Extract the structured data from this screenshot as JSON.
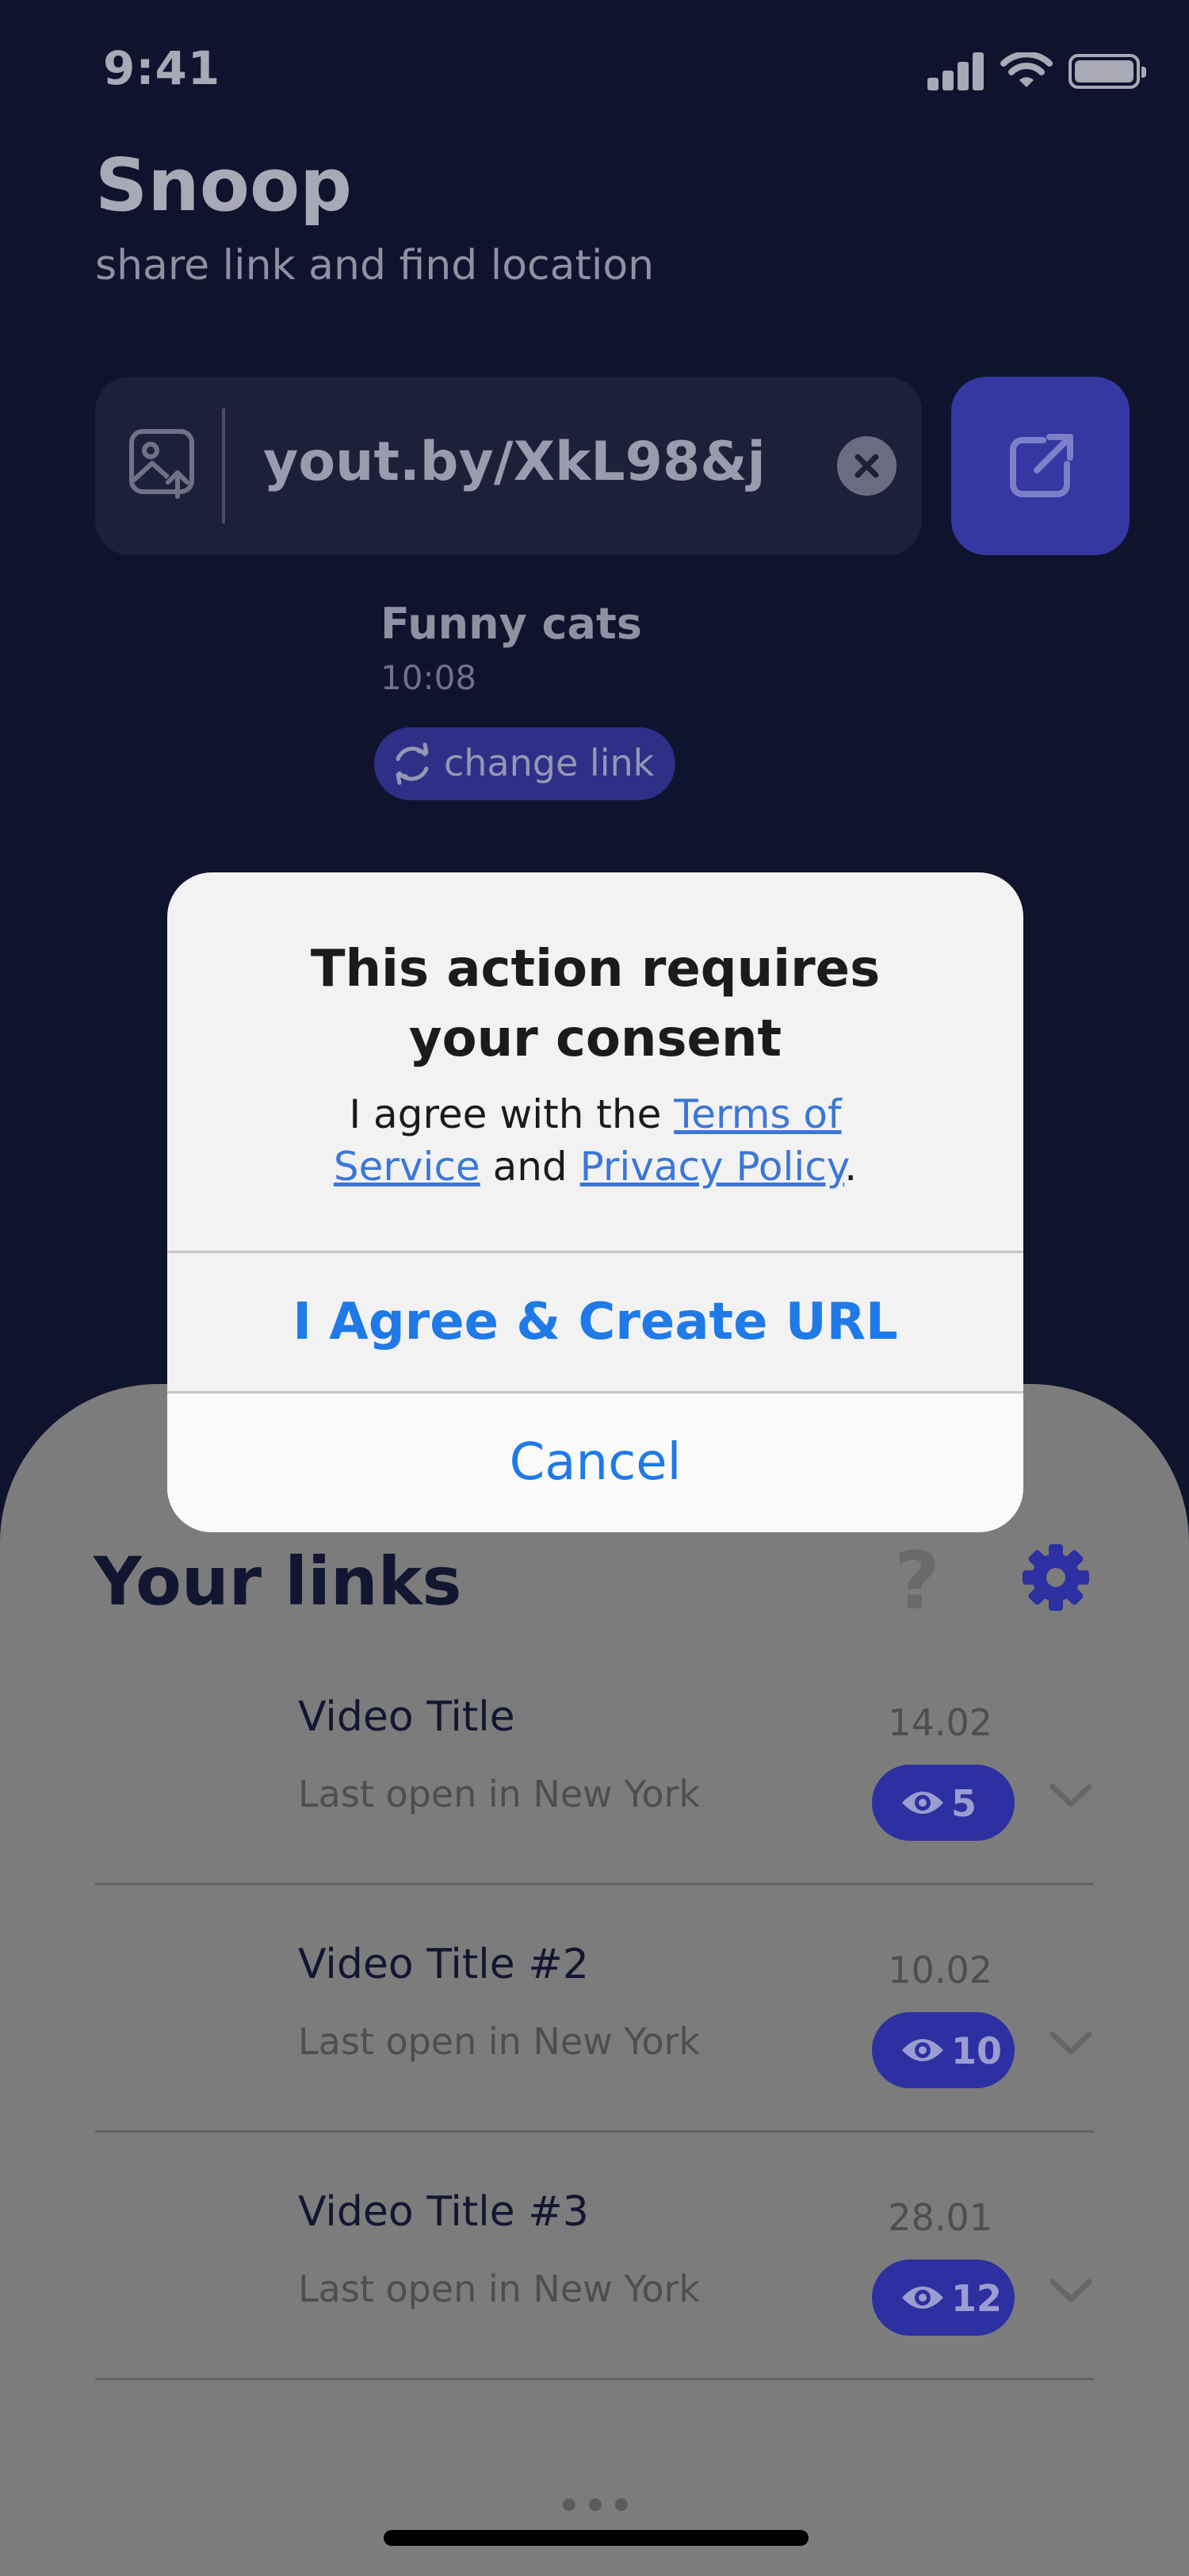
{
  "status_bar": {
    "time": "9:41"
  },
  "header": {
    "title": "Snoop",
    "subtitle": "share link and find location"
  },
  "link_field": {
    "value": "yout.by/XkL98&j"
  },
  "current_video": {
    "title": "Funny cats",
    "time": "10:08",
    "change_link_label": "change link"
  },
  "sheet": {
    "title": "Your links",
    "help_symbol": "?",
    "links": [
      {
        "title": "Video Title",
        "subtitle": "Last open in New York",
        "date": "14.02",
        "views": "5"
      },
      {
        "title": "Video Title #2",
        "subtitle": "Last open in New York",
        "date": "10.02",
        "views": "10"
      },
      {
        "title": "Video Title #3",
        "subtitle": "Last open in New York",
        "date": "28.01",
        "views": "12"
      }
    ]
  },
  "alert": {
    "title": "This action requires your consent",
    "message_prefix": "I agree with the ",
    "terms_link": "Terms of Service",
    "message_middle": " and ",
    "privacy_link": "Privacy Policy",
    "message_suffix": ".",
    "primary_button": "I Agree & Create URL",
    "cancel_button": "Cancel"
  },
  "icons": {
    "image_upload": "image-upload-icon",
    "clear": "clear-icon",
    "share": "external-link-icon",
    "refresh": "refresh-icon",
    "help": "help-icon",
    "settings": "gear-icon",
    "views": "eye-icon",
    "expand": "chevron-down-icon"
  },
  "colors": {
    "background": "#0f132e",
    "accent": "#3538a0",
    "sheet_dimmed": "#7c7c7c",
    "alert_action": "#1f7ae8"
  }
}
